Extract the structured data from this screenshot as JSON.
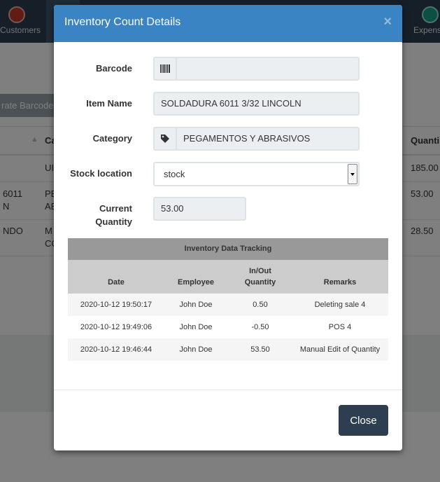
{
  "background": {
    "nav": {
      "customers_label": "Customers",
      "expenses_label": "Expenses"
    },
    "generate_barcodes_label": "rate Barcodes",
    "table": {
      "headers": [
        "Ca",
        "Quanti"
      ],
      "rows": [
        {
          "col1": "",
          "col2": "UI",
          "qty": "185.00"
        },
        {
          "col1": "6011",
          "col1b": "N",
          "col2": "PE",
          "col2b": "AE",
          "qty": "53.00"
        },
        {
          "col1": "NDO",
          "col2": "M",
          "col2b": "CO",
          "qty": "28.50"
        }
      ]
    }
  },
  "modal": {
    "title": "Inventory Count Details",
    "close_icon": "×",
    "fields": {
      "barcode_label": "Barcode",
      "barcode_value": "",
      "barcode_icon": "barcode-icon",
      "item_name_label": "Item Name",
      "item_name_value": "SOLDADURA 6011 3/32 LINCOLN",
      "category_label": "Category",
      "category_value": "PEGAMENTOS Y ABRASIVOS",
      "category_icon": "tag-icon",
      "stock_location_label": "Stock location",
      "stock_location_value": "stock",
      "current_quantity_label_1": "Current",
      "current_quantity_label_2": "Quantity",
      "current_quantity_value": "53.00"
    },
    "tracking": {
      "title": "Inventory Data Tracking",
      "headers": {
        "date": "Date",
        "employee": "Employee",
        "inout_1": "In/Out",
        "inout_2": "Quantity",
        "remarks": "Remarks"
      },
      "rows": [
        {
          "date": "2020-10-12 19:50:17",
          "employee": "John Doe",
          "qty": "0.50",
          "remarks": "Deleting sale 4"
        },
        {
          "date": "2020-10-12 19:49:06",
          "employee": "John Doe",
          "qty": "-0.50",
          "remarks": "POS 4"
        },
        {
          "date": "2020-10-12 19:46:44",
          "employee": "John Doe",
          "qty": "53.50",
          "remarks": "Manual Edit of Quantity"
        }
      ]
    },
    "close_button_label": "Close"
  },
  "colors": {
    "header_blue": "#3a84c4",
    "topbar": "#2c3e50",
    "close_button": "#2c3e50"
  }
}
